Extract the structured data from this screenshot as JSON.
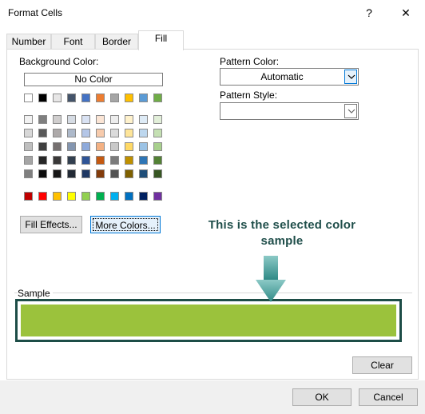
{
  "window": {
    "title": "Format Cells",
    "help": "?",
    "close": "✕"
  },
  "tabs": [
    {
      "label": "Number"
    },
    {
      "label": "Font"
    },
    {
      "label": "Border"
    },
    {
      "label": "Fill",
      "active": true
    }
  ],
  "fill": {
    "background_color_label": "Background Color:",
    "no_color_label": "No Color",
    "theme_top_row": [
      "#ffffff",
      "#000000",
      "#e7e6e6",
      "#44546a",
      "#4472c4",
      "#ed7d31",
      "#a5a5a5",
      "#ffc000",
      "#5b9bd5",
      "#70ad47"
    ],
    "theme_shades": [
      [
        "#f2f2f2",
        "#7f7f7f",
        "#d0cece",
        "#d6dce4",
        "#d9e2f3",
        "#fbe5d5",
        "#ededed",
        "#fff2cc",
        "#deebf6",
        "#e2efd9"
      ],
      [
        "#d8d8d8",
        "#595959",
        "#aeaaaa",
        "#adb9ca",
        "#b4c6e7",
        "#f7cbac",
        "#dbdbdb",
        "#fee599",
        "#bdd7ee",
        "#c5e0b3"
      ],
      [
        "#bfbfbf",
        "#3f3f3f",
        "#757070",
        "#8496b0",
        "#8eaadb",
        "#f4b183",
        "#c9c9c9",
        "#ffd965",
        "#9cc3e5",
        "#a8d08d"
      ],
      [
        "#a5a5a5",
        "#262626",
        "#3a3838",
        "#323f4f",
        "#2f5496",
        "#c45911",
        "#7b7b7b",
        "#bf9000",
        "#2e75b5",
        "#538135"
      ],
      [
        "#7f7f7f",
        "#0c0c0c",
        "#171616",
        "#222a35",
        "#1f3864",
        "#833c0b",
        "#525252",
        "#7f6000",
        "#1f4e79",
        "#375623"
      ]
    ],
    "standard_colors": [
      "#c00000",
      "#ff0000",
      "#ffc000",
      "#ffff00",
      "#92d050",
      "#00b050",
      "#00b0f0",
      "#0070c0",
      "#002060",
      "#7030a0"
    ],
    "fill_effects_label": "Fill Effects...",
    "more_colors_label": "More Colors...",
    "pattern_color_label": "Pattern Color:",
    "pattern_color_value": "Automatic",
    "pattern_style_label": "Pattern Style:",
    "pattern_style_value": "",
    "sample_label": "Sample",
    "sample_color": "#9bc23c",
    "clear_label": "Clear"
  },
  "annotation": {
    "text": "This is the selected color sample",
    "color": "#1f4e4a"
  },
  "footer": {
    "ok_label": "OK",
    "cancel_label": "Cancel"
  }
}
